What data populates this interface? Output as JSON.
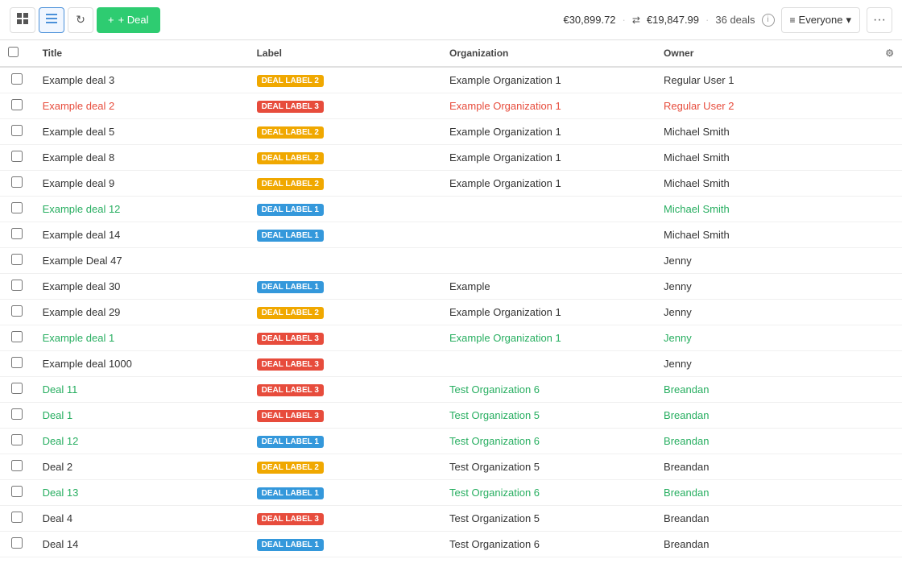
{
  "toolbar": {
    "grid_icon": "⊞",
    "list_icon": "≡",
    "refresh_icon": "↻",
    "add_label": "+ Deal",
    "stat1": "€30,899.72",
    "sep1": "·",
    "transfer_icon": "⇄",
    "stat2": "€19,847.99",
    "sep2": "·",
    "deals_count": "36 deals",
    "filter_icon": "≡",
    "everyone_label": "Everyone",
    "chevron_down": "▾",
    "more_icon": "···"
  },
  "table": {
    "headers": [
      "",
      "Title",
      "Label",
      "Organization",
      "Owner",
      ""
    ],
    "rows": [
      {
        "title": "Example deal 3",
        "title_style": "normal",
        "label": "DEAL LABEL 2",
        "label_color": "yellow",
        "org": "Example Organization 1",
        "org_style": "normal",
        "owner": "Regular User 1",
        "owner_style": "normal"
      },
      {
        "title": "Example deal 2",
        "title_style": "red",
        "label": "DEAL LABEL 3",
        "label_color": "red",
        "org": "Example Organization 1",
        "org_style": "red",
        "owner": "Regular User 2",
        "owner_style": "red"
      },
      {
        "title": "Example deal 5",
        "title_style": "normal",
        "label": "DEAL LABEL 2",
        "label_color": "yellow",
        "org": "Example Organization 1",
        "org_style": "normal",
        "owner": "Michael Smith",
        "owner_style": "normal"
      },
      {
        "title": "Example deal 8",
        "title_style": "normal",
        "label": "DEAL LABEL 2",
        "label_color": "yellow",
        "org": "Example Organization 1",
        "org_style": "normal",
        "owner": "Michael Smith",
        "owner_style": "normal"
      },
      {
        "title": "Example deal 9",
        "title_style": "normal",
        "label": "DEAL LABEL 2",
        "label_color": "yellow",
        "org": "Example Organization 1",
        "org_style": "normal",
        "owner": "Michael Smith",
        "owner_style": "normal"
      },
      {
        "title": "Example deal 12",
        "title_style": "green",
        "label": "DEAL LABEL 1",
        "label_color": "blue",
        "org": "",
        "org_style": "normal",
        "owner": "Michael Smith",
        "owner_style": "green"
      },
      {
        "title": "Example deal 14",
        "title_style": "normal",
        "label": "DEAL LABEL 1",
        "label_color": "blue",
        "org": "",
        "org_style": "normal",
        "owner": "Michael Smith",
        "owner_style": "normal"
      },
      {
        "title": "Example Deal 47",
        "title_style": "normal",
        "label": "",
        "label_color": "",
        "org": "",
        "org_style": "normal",
        "owner": "Jenny",
        "owner_style": "normal"
      },
      {
        "title": "Example deal 30",
        "title_style": "normal",
        "label": "DEAL LABEL 1",
        "label_color": "blue",
        "org": "Example",
        "org_style": "normal",
        "owner": "Jenny",
        "owner_style": "normal"
      },
      {
        "title": "Example deal 29",
        "title_style": "normal",
        "label": "DEAL LABEL 2",
        "label_color": "yellow",
        "org": "Example Organization 1",
        "org_style": "normal",
        "owner": "Jenny",
        "owner_style": "normal"
      },
      {
        "title": "Example deal 1",
        "title_style": "green",
        "label": "DEAL LABEL 3",
        "label_color": "red",
        "org": "Example Organization 1",
        "org_style": "green",
        "owner": "Jenny",
        "owner_style": "green"
      },
      {
        "title": "Example deal 1000",
        "title_style": "normal",
        "label": "DEAL LABEL 3",
        "label_color": "red",
        "org": "",
        "org_style": "normal",
        "owner": "Jenny",
        "owner_style": "normal"
      },
      {
        "title": "Deal 11",
        "title_style": "green",
        "label": "DEAL LABEL 3",
        "label_color": "red",
        "org": "Test Organization 6",
        "org_style": "green",
        "owner": "Breandan",
        "owner_style": "green"
      },
      {
        "title": "Deal 1",
        "title_style": "green",
        "label": "DEAL LABEL 3",
        "label_color": "red",
        "org": "Test Organization 5",
        "org_style": "green",
        "owner": "Breandan",
        "owner_style": "green"
      },
      {
        "title": "Deal 12",
        "title_style": "green",
        "label": "DEAL LABEL 1",
        "label_color": "blue",
        "org": "Test Organization 6",
        "org_style": "green",
        "owner": "Breandan",
        "owner_style": "green"
      },
      {
        "title": "Deal 2",
        "title_style": "normal",
        "label": "DEAL LABEL 2",
        "label_color": "yellow",
        "org": "Test Organization 5",
        "org_style": "normal",
        "owner": "Breandan",
        "owner_style": "normal"
      },
      {
        "title": "Deal 13",
        "title_style": "green",
        "label": "DEAL LABEL 1",
        "label_color": "blue",
        "org": "Test Organization 6",
        "org_style": "green",
        "owner": "Breandan",
        "owner_style": "green"
      },
      {
        "title": "Deal 4",
        "title_style": "normal",
        "label": "DEAL LABEL 3",
        "label_color": "red",
        "org": "Test Organization 5",
        "org_style": "normal",
        "owner": "Breandan",
        "owner_style": "normal"
      },
      {
        "title": "Deal 14",
        "title_style": "normal",
        "label": "DEAL LABEL 1",
        "label_color": "blue",
        "org": "Test Organization 6",
        "org_style": "normal",
        "owner": "Breandan",
        "owner_style": "normal"
      }
    ]
  }
}
